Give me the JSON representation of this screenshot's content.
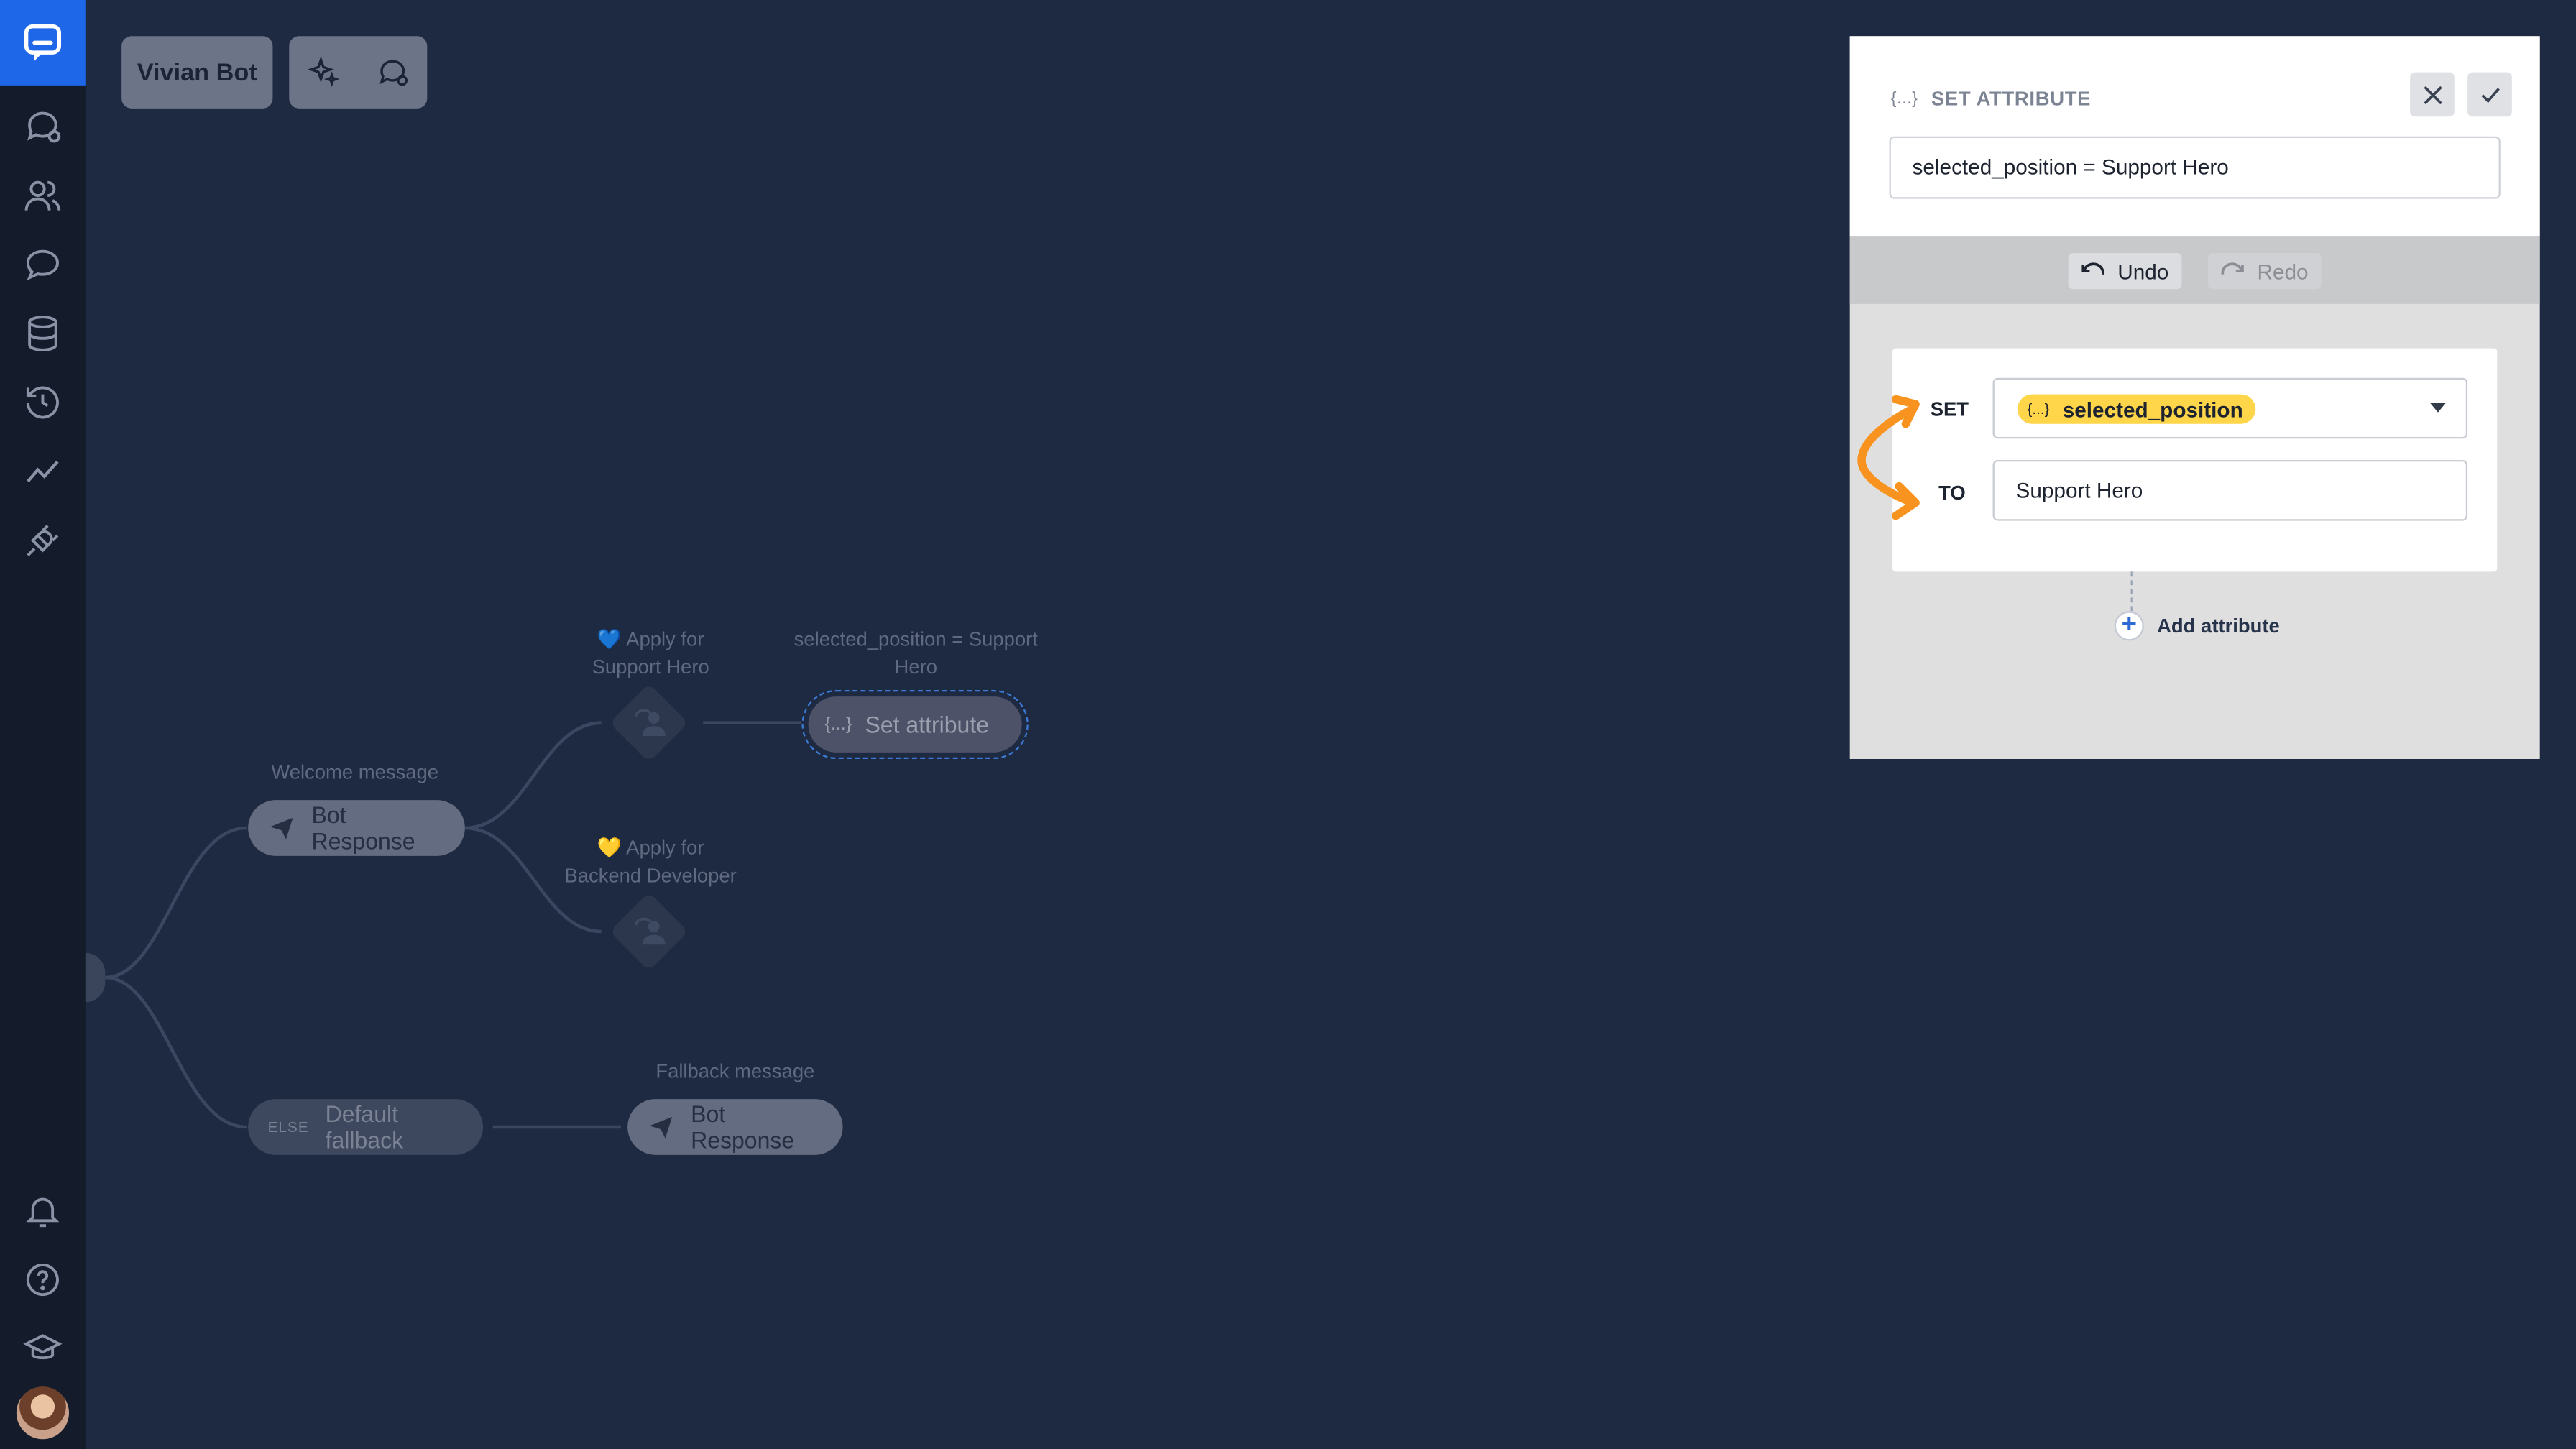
{
  "sidebar": {
    "logo": "chat-logo-icon",
    "items": [
      {
        "icon": "chat-bubbles-icon"
      },
      {
        "icon": "users-icon"
      },
      {
        "icon": "speech-bubble-icon"
      },
      {
        "icon": "database-icon"
      },
      {
        "icon": "history-icon"
      },
      {
        "icon": "analytics-icon"
      },
      {
        "icon": "plug-icon"
      }
    ],
    "bottom_items": [
      {
        "icon": "bell-icon"
      },
      {
        "icon": "help-icon"
      },
      {
        "icon": "graduation-cap-icon"
      }
    ],
    "avatar": "user-avatar"
  },
  "toolbar": {
    "bot_name": "Vivian Bot",
    "tools": [
      "sparkles-icon",
      "test-chat-icon"
    ]
  },
  "flow": {
    "welcome_label": "Welcome message",
    "welcome_node": "Bot Response",
    "branch_1_label_line1": "💙 Apply for",
    "branch_1_label_line2": "Support Hero",
    "branch_2_label_line1": "💛 Apply for",
    "branch_2_label_line2": "Backend Developer",
    "set_attr_label_line1": "selected_position = Support",
    "set_attr_label_line2": "Hero",
    "set_attr_node": "Set attribute",
    "set_attr_icon_text": "{...}",
    "fallback_tag": "ELSE",
    "fallback_node": "Default fallback",
    "fallback_msg_label": "Fallback message",
    "fallback_msg_node": "Bot Response"
  },
  "panel": {
    "title": "SET ATTRIBUTE",
    "title_icon_text": "{...}",
    "summary_value": "selected_position = Support Hero",
    "undo_label": "Undo",
    "redo_label": "Redo",
    "set_label": "SET",
    "to_label": "TO",
    "attribute_icon_text": "{...}",
    "attribute_name": "selected_position",
    "to_value": "Support Hero",
    "add_attribute_label": "Add attribute"
  },
  "colors": {
    "canvas_bg": "#1e2942",
    "sidebar_bg": "#141b2b",
    "brand_blue": "#1e67e8",
    "attribute_chip": "#ffd54a",
    "annotation_arrow": "#f7931e"
  }
}
